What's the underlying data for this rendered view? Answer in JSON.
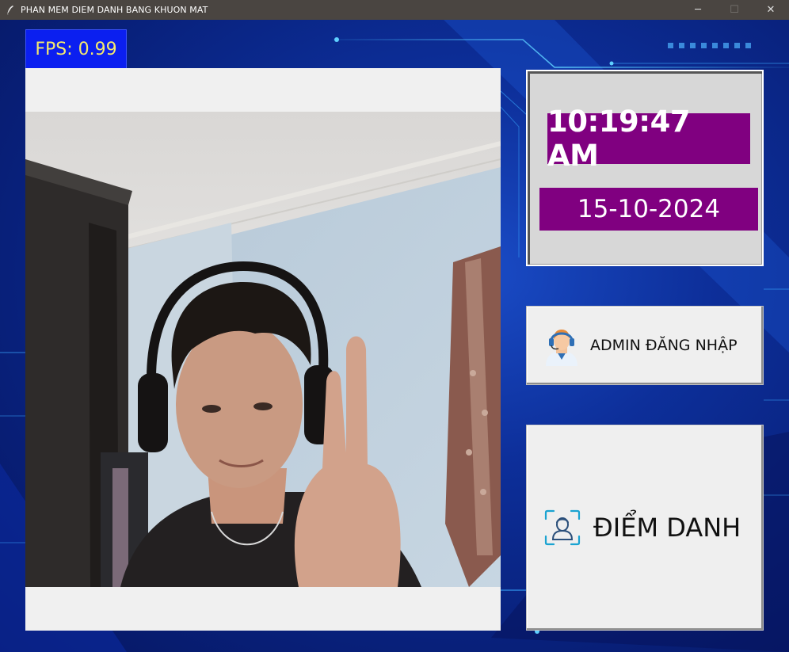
{
  "window": {
    "title": "PHAN MEM DIEM DANH BANG KHUON MAT",
    "minimize": "─",
    "maximize": "☐",
    "close": "✕"
  },
  "fps": {
    "label": "FPS: 0.99"
  },
  "camera": {
    "icon": "camera-feed"
  },
  "clock": {
    "time": "10:19:47 AM",
    "date": "15-10-2024",
    "accent": "#800080"
  },
  "buttons": {
    "admin_login": {
      "label": "ADMIN ĐĂNG NHẬP",
      "icon": "admin-avatar-icon"
    },
    "attendance": {
      "label": "ĐIỂM DANH",
      "icon": "face-scan-icon"
    }
  },
  "colors": {
    "fps_bg": "#0b1ff0",
    "fps_text": "#f5e96e",
    "background": "#0d2f9a"
  }
}
